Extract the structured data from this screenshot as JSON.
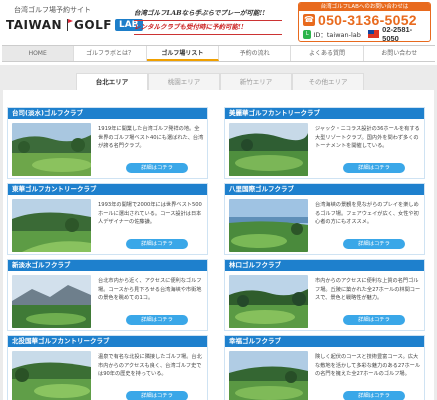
{
  "header": {
    "site_tag": "台湾ゴルフ場予約サイト",
    "logo_taiwan": "TAIWAN",
    "logo_golf": "GOLF",
    "logo_lab": "LAB",
    "tagline_1": "台湾ゴルフLABなら手ぶらでプレーが可能!!",
    "tagline_2": "レンタルクラブも受付時に予約可能!!",
    "contact_title": "台湾ゴルフLABへのお問い合わせは",
    "phone": "050-3136-5052",
    "line_label": "ID：taiwan-lab",
    "tw_phone": "02-2581-5050",
    "accent_color": "#e86a1e"
  },
  "nav": {
    "items": [
      "HOME",
      "ゴルフラボとは？",
      "ゴルフ場リスト",
      "予約の流れ",
      "よくある質問",
      "お問い合わせ"
    ],
    "active_index": 2
  },
  "tabs": [
    "台北エリア",
    "桃園エリア",
    "新竹エリア",
    "その他エリア"
  ],
  "active_tab": 0,
  "detail_label": "詳細はコチラ",
  "courses": [
    {
      "name": "台司(淡水)ゴルフクラブ",
      "desc": "1919年に開業した台湾ゴルフ発祥の地。全世界のゴルフ場ベスト40にも選ばれた、台湾が誇る名門クラブ。"
    },
    {
      "name": "美麗華ゴルフカントリークラブ",
      "desc": "ジャック・ニコラス設計の36ホールを有する大型リゾートクラブ。国内外を問わず多くのトーナメントを開催している。"
    },
    {
      "name": "東華ゴルフカントリークラブ",
      "desc": "1993年の開場で2000年には世界ベスト500ホールに選出されている。コース設計は日本人デザイナーの佐藤謙。"
    },
    {
      "name": "八里国際ゴルフクラブ",
      "desc": "台湾海峡の景観を見ながらのプレイを楽しめるゴルフ場。フェアウェイが広く、女性や初心者の方にもオススメ。"
    },
    {
      "name": "新淡水ゴルフクラブ",
      "desc": "台北市内から近く、アクセスに便利なゴルフ場。コースから見下ろせる台湾海峡や市街地の景色を眺めての1コ。"
    },
    {
      "name": "林口ゴルフクラブ",
      "desc": "市内からのアクセスに便利な上質の名門ゴルフ場。丘陵に築かれた全27ホールの林間コースで、景色と戦略性が魅力。"
    },
    {
      "name": "北投国華ゴルフカントリークラブ",
      "desc": "温泉で有名な北投に隣接したゴルフ場。台北市内からのアクセスも良く、台湾ゴルフ史では90年の歴史を持っている。"
    },
    {
      "name": "幸福ゴルフクラブ",
      "desc": "険しく起伏のコースと技術豊富コース。広大な敷地を活かして多彩な魅力のある27ホールの名門を擁えた全27ホールのゴルフ場。"
    }
  ]
}
